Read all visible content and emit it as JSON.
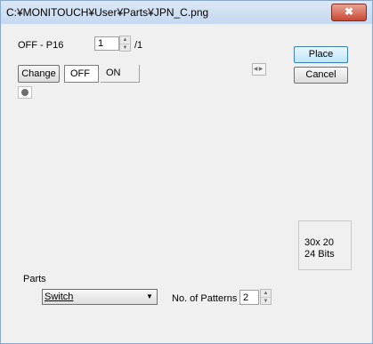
{
  "window": {
    "title": "C:¥MONITOUCH¥User¥Parts¥JPN_C.png",
    "close_symbol": "✖"
  },
  "pattern": {
    "label": "OFF - P16",
    "value": "1",
    "total": "/1"
  },
  "buttons": {
    "place": "Place",
    "cancel": "Cancel",
    "change": "Change"
  },
  "state_tabs": {
    "off": "OFF",
    "on": "ON"
  },
  "image_info": {
    "size": "30x  20",
    "bits": "24 Bits"
  },
  "parts": {
    "label": "Parts",
    "selected": "Switch",
    "patterns_label": "No. of Patterns",
    "patterns_value": "2"
  },
  "icons": {
    "spin_up": "▲",
    "spin_down": "▼",
    "left": "◀",
    "right": "▶",
    "dropdown": "▼"
  }
}
